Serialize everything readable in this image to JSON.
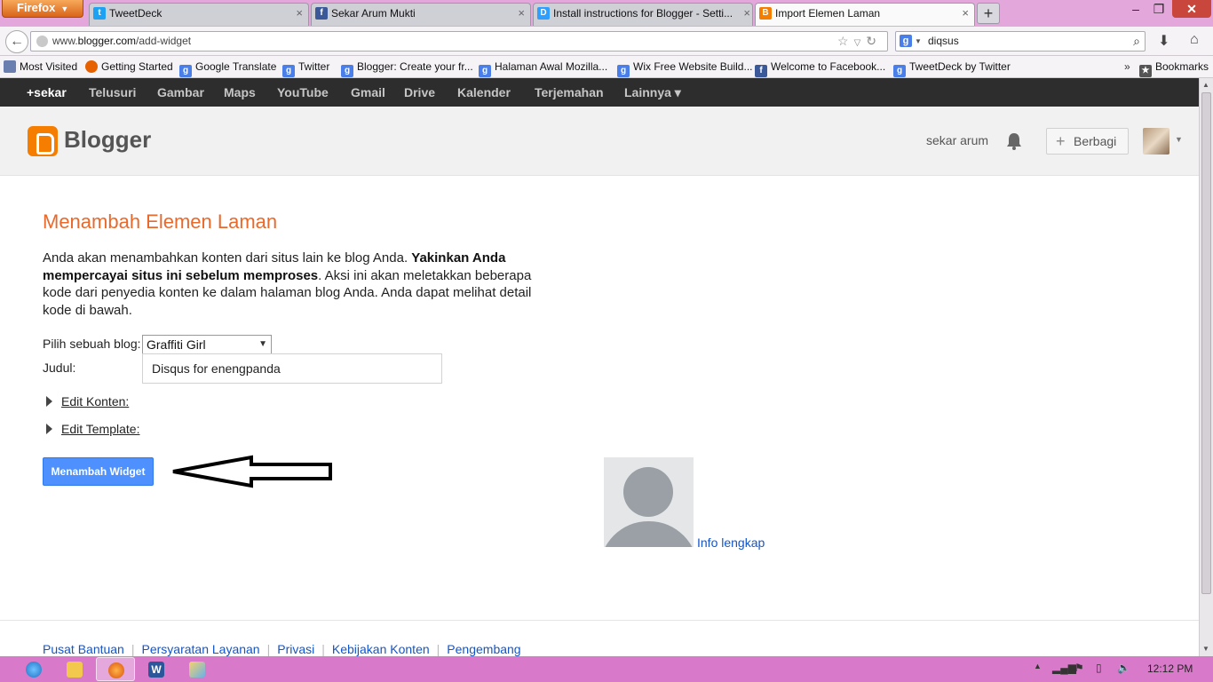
{
  "browser": {
    "menu_label": "Firefox",
    "tabs": [
      {
        "label": "TweetDeck",
        "favicon": "twitter-icon",
        "color": "#1da1f2",
        "glyph": "t"
      },
      {
        "label": "Sekar Arum Mukti",
        "favicon": "facebook-icon",
        "color": "#3b5998",
        "glyph": "f"
      },
      {
        "label": "Install instructions for Blogger - Setti...",
        "favicon": "disqus-icon",
        "color": "#2e9fff",
        "glyph": "D"
      },
      {
        "label": "Import Elemen Laman",
        "favicon": "blogger-icon",
        "color": "#f57d00",
        "glyph": "B"
      }
    ],
    "url_prefix": "www.",
    "url_domain": "blogger.com",
    "url_path": "/add-widget",
    "search_value": "diqsus",
    "bookmarks": [
      {
        "label": "Most Visited"
      },
      {
        "label": "Getting Started"
      },
      {
        "label": "Google Translate"
      },
      {
        "label": "Twitter"
      },
      {
        "label": "Blogger: Create your fr..."
      },
      {
        "label": "Halaman Awal Mozilla..."
      },
      {
        "label": "Wix Free Website Build..."
      },
      {
        "label": "Welcome to Facebook..."
      },
      {
        "label": "TweetDeck by Twitter"
      }
    ],
    "bookmarks_menu_label": "Bookmarks"
  },
  "google_bar": {
    "items": [
      "+sekar",
      "Telusuri",
      "Gambar",
      "Maps",
      "YouTube",
      "Gmail",
      "Drive",
      "Kalender",
      "Terjemahan",
      "Lainnya ▾"
    ]
  },
  "blogger_header": {
    "logo_text": "Blogger",
    "user_name": "sekar arum",
    "share_label": "Berbagi"
  },
  "page": {
    "title": "Menambah Elemen Laman",
    "desc_part1": "Anda akan menambahkan konten dari situs lain ke blog Anda. ",
    "desc_bold": "Yakinkan Anda mempercayai situs ini sebelum memproses",
    "desc_part2": ". Aksi ini akan meletakkan beberapa kode dari penyedia konten ke dalam halaman blog Anda. Anda dapat melihat detail kode di bawah.",
    "blog_label": "Pilih sebuah blog:",
    "blog_selected": "Graffiti Girl",
    "title_label": "Judul:",
    "title_value": "Disqus for enengpanda",
    "edit_content_label": "Edit Konten:",
    "edit_template_label": "Edit Template:",
    "add_button_label": "Menambah Widget",
    "info_link": "Info lengkap"
  },
  "footer": {
    "links": [
      "Pusat Bantuan",
      "Persyaratan Layanan",
      "Privasi",
      "Kebijakan Konten",
      "Pengembang"
    ]
  },
  "taskbar": {
    "time": "12:12 PM"
  },
  "colors": {
    "accent_orange": "#e8692c",
    "button_blue": "#4d90fe",
    "link_blue": "#1155cc",
    "taskbar_pink": "#d87ac9"
  }
}
